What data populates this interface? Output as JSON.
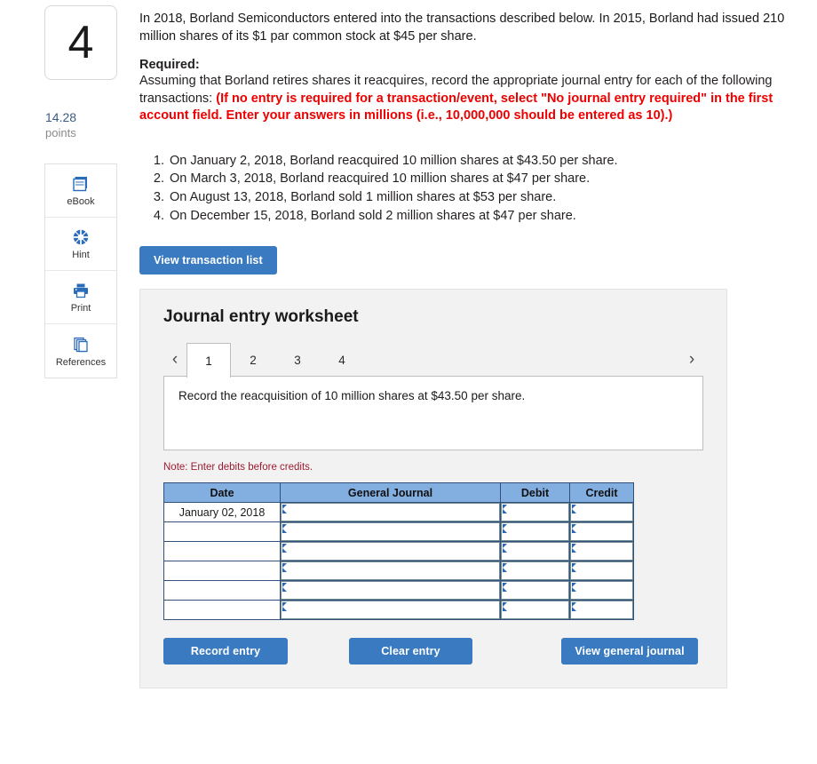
{
  "question": {
    "number": "4",
    "points_value": "14.28",
    "points_label": "points"
  },
  "tools": [
    {
      "label": "eBook",
      "icon": "book-icon"
    },
    {
      "label": "Hint",
      "icon": "life-ring-icon"
    },
    {
      "label": "Print",
      "icon": "printer-icon"
    },
    {
      "label": "References",
      "icon": "pages-stack-icon"
    }
  ],
  "prompt": {
    "intro": "In 2018, Borland Semiconductors entered into the transactions described below. In 2015, Borland had issued 210 million shares of its $1 par common stock at $45 per share.",
    "required_label": "Required:",
    "required_black": "Assuming that Borland retires shares it reacquires, record the appropriate journal entry for each of the following transactions:",
    "required_red": "(If no entry is required for a transaction/event, select \"No journal entry required\" in the first account field. Enter your answers in millions (i.e., 10,000,000 should be entered as 10).)",
    "transactions": [
      "On January 2, 2018, Borland reacquired 10 million shares at $43.50 per share.",
      "On March 3, 2018, Borland reacquired 10 million shares at $47 per share.",
      "On August 13, 2018, Borland sold 1 million shares at $53 per share.",
      "On December 15, 2018, Borland sold 2 million shares at $47 per share."
    ]
  },
  "view_transaction_list_label": "View transaction list",
  "worksheet": {
    "title": "Journal entry worksheet",
    "prev_arrow": "‹",
    "next_arrow": "›",
    "tabs": [
      {
        "label": "1",
        "active": true
      },
      {
        "label": "2",
        "active": false
      },
      {
        "label": "3",
        "active": false
      },
      {
        "label": "4",
        "active": false
      }
    ],
    "active_tab_prompt": "Record the reacquisition of 10 million shares at $43.50 per share.",
    "note": "Note: Enter debits before credits.",
    "table": {
      "headers": [
        "Date",
        "General Journal",
        "Debit",
        "Credit"
      ],
      "rows": [
        {
          "date": "January 02, 2018",
          "general_journal": "",
          "debit": "",
          "credit": ""
        },
        {
          "date": "",
          "general_journal": "",
          "debit": "",
          "credit": ""
        },
        {
          "date": "",
          "general_journal": "",
          "debit": "",
          "credit": ""
        },
        {
          "date": "",
          "general_journal": "",
          "debit": "",
          "credit": ""
        },
        {
          "date": "",
          "general_journal": "",
          "debit": "",
          "credit": ""
        },
        {
          "date": "",
          "general_journal": "",
          "debit": "",
          "credit": ""
        }
      ]
    },
    "actions": {
      "record_entry": "Record entry",
      "clear_entry": "Clear entry",
      "view_general_journal": "View general journal"
    }
  },
  "colors": {
    "button_blue": "#3a7ac0",
    "table_header_blue": "#83aee0",
    "required_red": "#ee0000",
    "note_red": "#9e1b32",
    "points_blue": "#3a5b86",
    "panel_gray": "#f2f2f2"
  }
}
